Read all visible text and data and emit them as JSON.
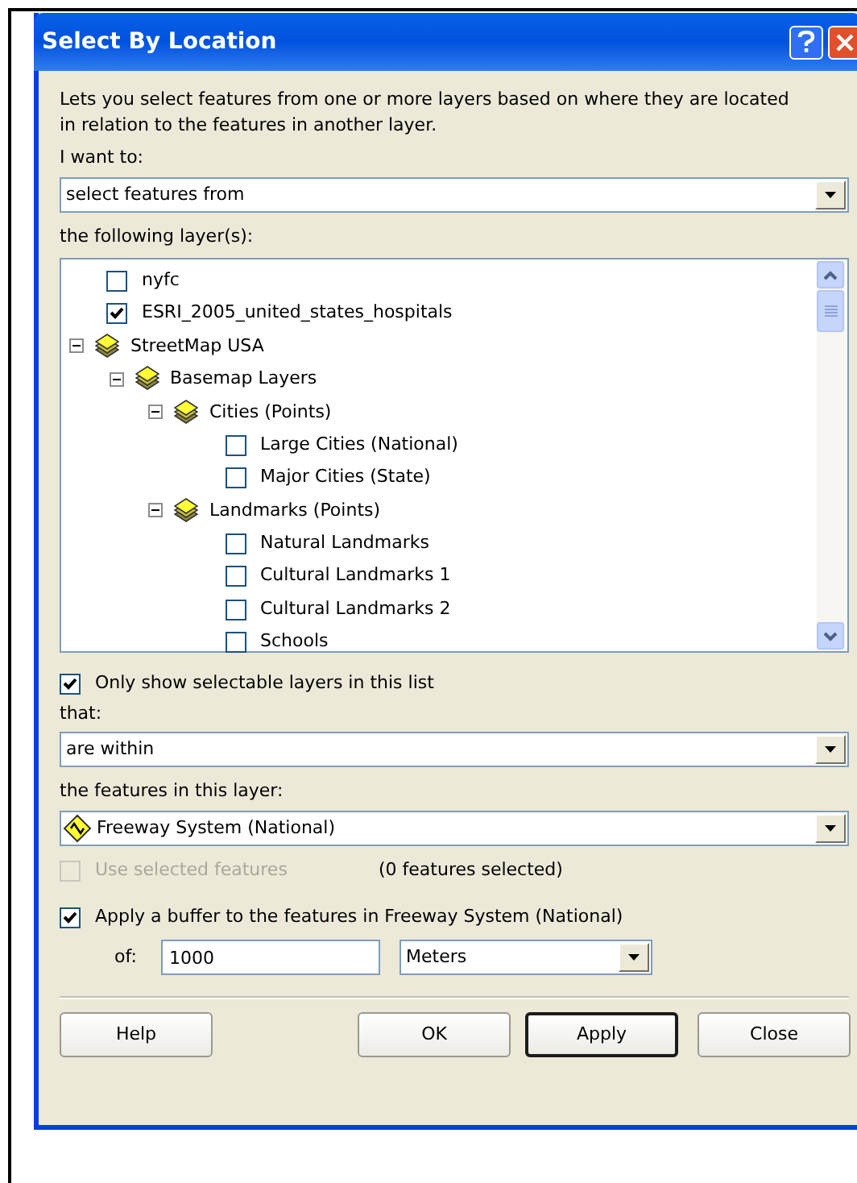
{
  "window": {
    "title": "Select By Location"
  },
  "description": "Lets you select features from one or more layers based on where they are located in relation to the features in another layer.",
  "method": {
    "label": "I want to:",
    "value": "select features from"
  },
  "layers_label": "the following layer(s):",
  "layers": [
    {
      "kind": "layer",
      "label": "nyfc",
      "checked": false
    },
    {
      "kind": "layer",
      "label": "ESRI_2005_united_states_hospitals",
      "checked": true
    },
    {
      "kind": "group",
      "label": "StreetMap USA",
      "expanded": true,
      "children": [
        {
          "kind": "group",
          "label": "Basemap Layers",
          "expanded": true,
          "children": [
            {
              "kind": "group",
              "label": "Cities (Points)",
              "expanded": true,
              "children": [
                {
                  "kind": "layer",
                  "label": "Large Cities (National)",
                  "checked": false
                },
                {
                  "kind": "layer",
                  "label": "Major Cities (State)",
                  "checked": false
                }
              ]
            },
            {
              "kind": "group",
              "label": "Landmarks (Points)",
              "expanded": true,
              "children": [
                {
                  "kind": "layer",
                  "label": "Natural Landmarks",
                  "checked": false
                },
                {
                  "kind": "layer",
                  "label": "Cultural Landmarks 1",
                  "checked": false
                },
                {
                  "kind": "layer",
                  "label": "Cultural Landmarks 2",
                  "checked": false
                },
                {
                  "kind": "layer",
                  "label": "Schools",
                  "checked": false
                }
              ]
            }
          ]
        }
      ]
    }
  ],
  "only_selectable": {
    "label": "Only show selectable layers in this list",
    "checked": true
  },
  "relation": {
    "label": "that:",
    "value": "are within"
  },
  "source_layer": {
    "label": "the features in this layer:",
    "value": "Freeway System (National)"
  },
  "use_selected": {
    "label": "Use selected features",
    "checked": false,
    "disabled": true,
    "count": "(0 features selected)"
  },
  "buffer": {
    "label": "Apply a buffer to the features in Freeway System (National)",
    "checked": true,
    "of_label": "of:",
    "distance": "1000",
    "units": "Meters"
  },
  "buttons": [
    {
      "label": "Help",
      "default": false
    },
    {
      "label": "OK",
      "default": false
    },
    {
      "label": "Apply",
      "default": true
    },
    {
      "label": "Close",
      "default": false
    }
  ]
}
